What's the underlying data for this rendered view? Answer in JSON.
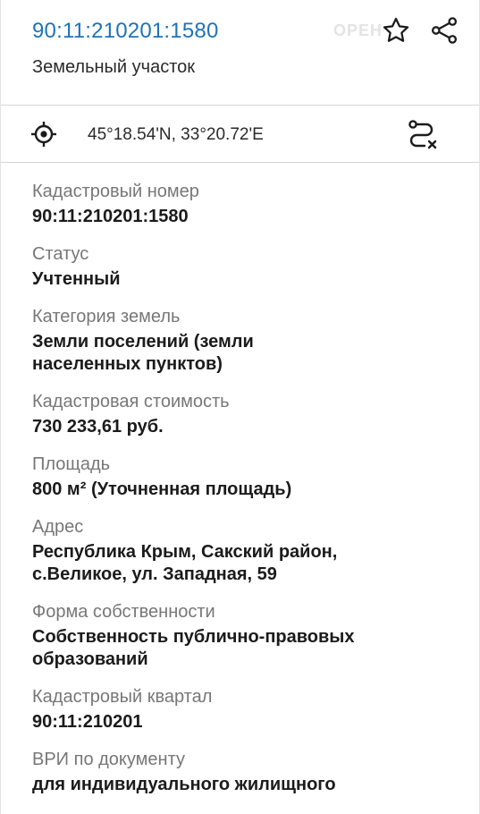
{
  "header": {
    "cadastral_number": "90:11:210201:1580",
    "object_type": "Земельный участок",
    "watermark": "ОРЕН"
  },
  "icons": {
    "favorite": "star-icon",
    "share": "share-icon",
    "locate": "crosshair-icon",
    "route": "route-cancel-icon"
  },
  "coords": {
    "text": "45°18.54'N, 33°20.72'E"
  },
  "fields": [
    {
      "label": "Кадастровый номер",
      "value": "90:11:210201:1580"
    },
    {
      "label": "Статус",
      "value": "Учтенный"
    },
    {
      "label": "Категория земель",
      "value": "Земли поселений (земли\nнаселенных пунктов)"
    },
    {
      "label": "Кадастровая стоимость",
      "value": "730 233,61 руб."
    },
    {
      "label": "Площадь",
      "value": "800 м² (Уточненная площадь)"
    },
    {
      "label": "Адрес",
      "value": " Республика Крым, Сакский район,\nс.Великое, ул. Западная, 59"
    },
    {
      "label": "Форма собственности",
      "value": "Собственность публично-правовых\nобразований"
    },
    {
      "label": "Кадастровый квартал",
      "value": "90:11:210201"
    },
    {
      "label": "ВРИ по документу",
      "value": "для индивидуального жилищного"
    }
  ],
  "colors": {
    "accent": "#1f73b7",
    "label": "#777777",
    "value": "#1b1b1b",
    "divider": "#d6d6d6"
  }
}
